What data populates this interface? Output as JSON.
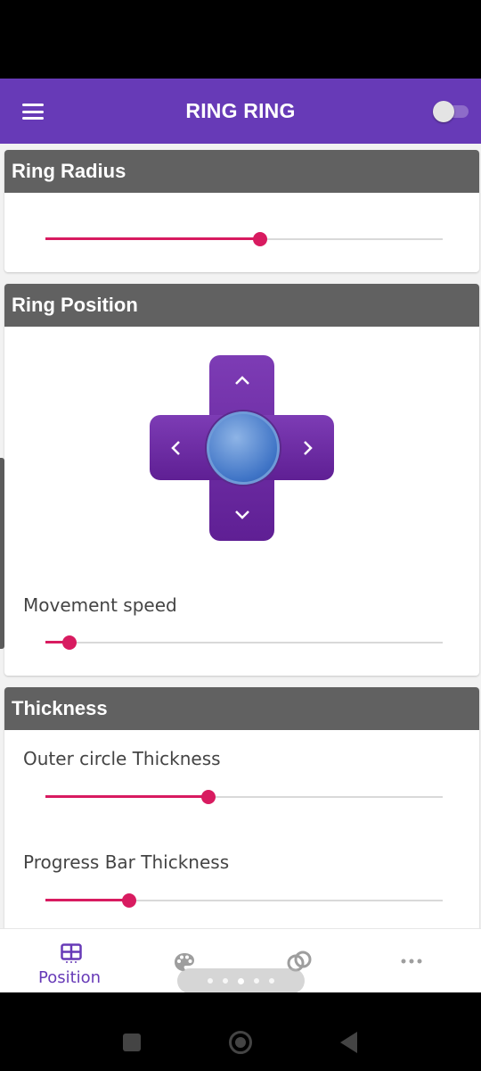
{
  "app_bar": {
    "title": "RING RING",
    "menu_icon": "hamburger-menu-icon",
    "toggle_on": false
  },
  "sections": {
    "radius": {
      "header": "Ring Radius",
      "slider_value": 0.54
    },
    "position": {
      "header": "Ring Position",
      "dpad_icons": [
        "chevron-up-icon",
        "chevron-left-icon",
        "chevron-right-icon",
        "chevron-down-icon"
      ],
      "speed_label": "Movement speed",
      "speed_value": 0.06
    },
    "thickness": {
      "header": "Thickness",
      "outer_label": "Outer circle Thickness",
      "outer_value": 0.41,
      "progress_label": "Progress Bar Thickness",
      "progress_value": 0.21
    }
  },
  "bottom_nav": {
    "items": [
      {
        "icon": "grid-icon",
        "label": "Position",
        "active": true
      },
      {
        "icon": "palette-icon",
        "label": "",
        "active": false
      },
      {
        "icon": "rings-icon",
        "label": "",
        "active": false
      },
      {
        "icon": "more-dots-icon",
        "label": "",
        "active": false
      }
    ],
    "page_indicator_count": 5,
    "page_indicator_active": 2
  },
  "colors": {
    "primary": "#673ab7",
    "accent": "#d81b60",
    "header_gray": "#616161"
  }
}
